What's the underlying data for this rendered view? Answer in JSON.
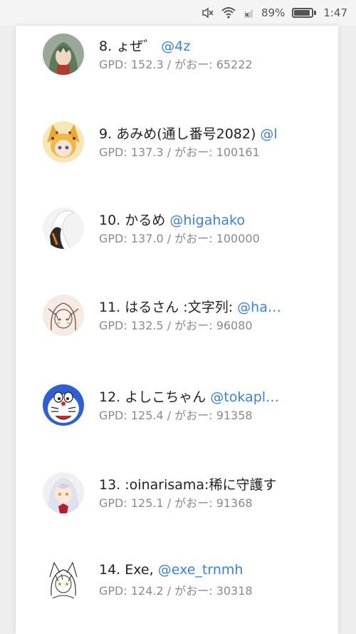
{
  "statusbar": {
    "battery_percent": "89%",
    "time": "1:47",
    "icons": [
      "mute-icon",
      "wifi-icon",
      "no-signal-icon",
      "battery-icon"
    ]
  },
  "colors": {
    "handle": "#3b82d6",
    "stats": "#8a8a8a",
    "name": "#222222"
  },
  "entries": [
    {
      "rank": "8.",
      "name": "ょぜ゛",
      "handle": "@4z",
      "stats": "GPD: 152.3 / がおー: 65222",
      "avatar": "green-hair-character-avatar"
    },
    {
      "rank": "9.",
      "name": "あみめ(通し番号2082)",
      "handle": "@l",
      "stats": "GPD: 137.3 / がおー: 100161",
      "avatar": "serval-character-avatar"
    },
    {
      "rank": "10.",
      "name": "かるめ",
      "handle": "@higahako",
      "stats": "GPD: 137.0 / がおー: 100000",
      "avatar": "swan-avatar"
    },
    {
      "rank": "11.",
      "name": "はるさん :文字列:",
      "handle": "@ha…",
      "stats": "GPD: 132.5 / がおー: 96080",
      "avatar": "sketch-girl-avatar"
    },
    {
      "rank": "12.",
      "name": "よしこちゃん",
      "handle": "@tokapl…",
      "stats": "GPD: 125.4 / がおー: 91358",
      "avatar": "blue-robot-cat-avatar"
    },
    {
      "rank": "13.",
      "name": ":oinarisama:稀に守護す",
      "handle": "",
      "stats": "GPD: 125.1 / がおー: 91368",
      "avatar": "silver-hair-girl-avatar"
    },
    {
      "rank": "14.",
      "name": "Exe,",
      "handle": "@exe_trnmh",
      "stats": "GPD: 124.2 / がおー: 30318",
      "avatar": "fox-girl-lineart-avatar"
    }
  ]
}
